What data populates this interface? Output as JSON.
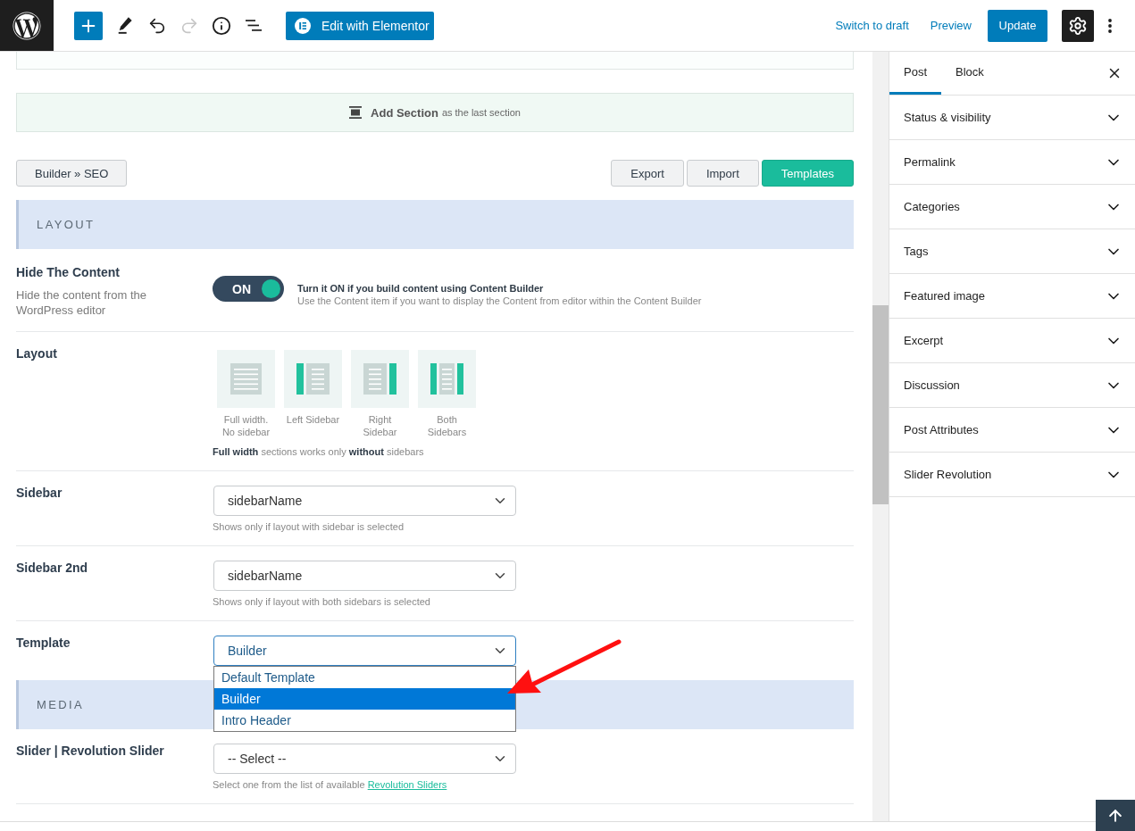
{
  "top_bar": {
    "tools": [
      {
        "kind": "add",
        "disabled": false
      },
      {
        "kind": "edit",
        "disabled": false
      },
      {
        "kind": "undo",
        "disabled": false
      },
      {
        "kind": "redo",
        "disabled": true
      },
      {
        "kind": "info",
        "disabled": false
      },
      {
        "kind": "outline",
        "disabled": false
      }
    ],
    "elementor_button": "Edit with Elementor",
    "switch_to_draft": "Switch to draft",
    "preview": "Preview",
    "update": "Update",
    "settings": {
      "pressed": true
    }
  },
  "builder": {
    "add_section": {
      "label": "Add Section",
      "note": "as the last section"
    },
    "breadcrumb": "Builder » SEO",
    "actions": [
      {
        "label": "Export",
        "primary": false
      },
      {
        "label": "Import",
        "primary": false
      },
      {
        "label": "Templates",
        "primary": true
      }
    ],
    "sections": [
      {
        "heading": "LAYOUT",
        "fields": [
          {
            "kind": "toggle",
            "label": "Hide The Content",
            "description": "Hide the content from the WordPress editor",
            "on": true,
            "toggle_text": "ON",
            "help_title": "Turn it ON if you build content using Content Builder",
            "help_text": "Use the Content item if you want to display the Content from editor within the Content Builder"
          },
          {
            "kind": "layout",
            "label": "Layout",
            "options": [
              {
                "kind": "full",
                "caption": "Full width. No sidebar",
                "selected": false
              },
              {
                "kind": "left",
                "caption": "Left Sidebar",
                "selected": false
              },
              {
                "kind": "right",
                "caption": "Right Sidebar",
                "selected": false
              },
              {
                "kind": "both",
                "caption": "Both Sidebars",
                "selected": false
              }
            ],
            "note": "**Full width** sections works only **without** sidebars"
          },
          {
            "kind": "select",
            "label": "Sidebar",
            "value": "sidebarName",
            "open": false,
            "hint": "Shows only if layout with sidebar is selected"
          },
          {
            "kind": "select",
            "label": "Sidebar 2nd",
            "value": "sidebarName",
            "open": false,
            "hint": "Shows only if layout with both sidebars is selected"
          },
          {
            "kind": "select",
            "label": "Template",
            "value": "Builder",
            "open": true,
            "options": [
              {
                "label": "Default Template",
                "selected": false
              },
              {
                "label": "Builder",
                "selected": true
              },
              {
                "label": "Intro Header",
                "selected": false
              }
            ]
          }
        ]
      },
      {
        "heading": "MEDIA",
        "fields": [
          {
            "kind": "select",
            "label": "Slider | Revolution Slider",
            "value": "-- Select --",
            "open": false,
            "hint": "Select one from the list of available",
            "hint_link": "Revolution Sliders"
          }
        ]
      }
    ]
  },
  "sidebar": {
    "tabs": [
      {
        "label": "Post",
        "selected": true
      },
      {
        "label": "Block",
        "selected": false
      }
    ],
    "panels": [
      {
        "label": "Status & visibility",
        "expanded": false
      },
      {
        "label": "Permalink",
        "expanded": false
      },
      {
        "label": "Categories",
        "expanded": false
      },
      {
        "label": "Tags",
        "expanded": false
      },
      {
        "label": "Featured image",
        "expanded": false
      },
      {
        "label": "Excerpt",
        "expanded": false
      },
      {
        "label": "Discussion",
        "expanded": false
      },
      {
        "label": "Post Attributes",
        "expanded": false
      },
      {
        "label": "Slider Revolution",
        "expanded": false
      }
    ]
  }
}
